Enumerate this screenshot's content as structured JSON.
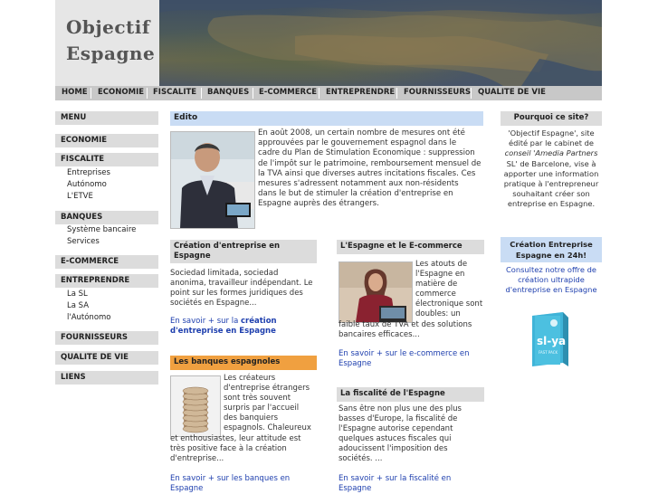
{
  "logo": {
    "line1": "Objectif",
    "line2": "Espagne"
  },
  "topnav": [
    "HOME",
    "ECONOMIE",
    "FISCALITE",
    "BANQUES",
    "E-COMMERCE",
    "ENTREPRENDRE",
    "FOURNISSEURS",
    "QUALITE DE VIE"
  ],
  "sidebar": {
    "menu": "MENU",
    "economie": "ECONOMIE",
    "fiscalite": "FISCALITE",
    "fiscalite_items": [
      "Entreprises",
      "Autónomo",
      "L'ETVE"
    ],
    "banques": "BANQUES",
    "banques_items": [
      "Système bancaire",
      "Services"
    ],
    "ecommerce": "E-COMMERCE",
    "entreprendre": "ENTREPRENDRE",
    "entreprendre_items": [
      "La SL",
      "La SA",
      "l'Autónomo"
    ],
    "fournisseurs": "FOURNISSEURS",
    "qualite": "QUALITE DE VIE",
    "liens": "LIENS"
  },
  "edito": {
    "title": "Edito",
    "lines": [
      "En août 2008, un certain nombre de mesures ont été",
      "approuvées par le gouvernement espagnol dans le",
      "cadre du Plan de Stimulation Economique : suppression",
      "de l'impôt sur le patrimoine, remboursement mensuel de",
      "la TVA ainsi que diverses autres incitations fiscales. Ces",
      "mesures s'adressent notamment aux non-résidents",
      "dans le but de stimuler la création d'entreprise en",
      "Espagne auprès des étrangers."
    ]
  },
  "creation": {
    "title_l1": "Création d'entreprise en",
    "title_l2": "Espagne",
    "lines": [
      "Sociedad limitada, sociedad",
      "anonima, travailleur indépendant. Le",
      "point sur les formes juridiques des",
      "sociétés en Espagne..."
    ],
    "link_l1a": "En savoir + sur la ",
    "link_l1b": "création",
    "link_l2": "d'entreprise en Espagne"
  },
  "ecommerce": {
    "title": "L'Espagne et le E-commerce",
    "lines": [
      "Les atouts de",
      "l'Espagne en",
      "matière de",
      "commerce",
      "électronique sont",
      "doubles: un",
      "faible taux de TVA et des solutions",
      "bancaires efficaces..."
    ],
    "link_l1": "En savoir + sur le e-commerce en",
    "link_l2": "Espagne"
  },
  "banques": {
    "title": "Les banques espagnoles",
    "lines": [
      "Les créateurs",
      "d'entreprise étrangers",
      "sont très souvent",
      "surpris par l'accueil",
      "des banquiers",
      "espagnols. Chaleureux",
      "et enthousiastes, leur attitude est",
      "très positive face à la création",
      "d'entreprise..."
    ],
    "link_l1": "En savoir + sur les banques en",
    "link_l2": "Espagne"
  },
  "fiscalite": {
    "title": "La fiscalité de l'Espagne",
    "lines": [
      "Sans être non plus une des plus",
      "basses d'Europe, la fiscalité de",
      "l'Espagne autorise cependant",
      "quelques astuces fiscales qui",
      "adoucissent l'imposition des",
      "sociétés. ..."
    ],
    "link_l1": "En savoir + sur la fiscalité en",
    "link_l2": "Espagne"
  },
  "right": {
    "head": "Pourquoi ce site?",
    "lines": [
      "'Objectif Espagne', site",
      "édité par le cabinet de",
      "conseil 'Amedia Partners",
      "SL' de Barcelone, vise à",
      "apporter une information",
      "pratique à l'entrepreneur",
      "souhaitant créer son",
      "entreprise en Espagne."
    ],
    "blue_l1": "Création Entreprise",
    "blue_l2": "Espagne en 24h!",
    "link_lines": [
      "Consultez notre offre de",
      "création ultrapide",
      "d'entreprise en Espagne"
    ],
    "box_label": "sl-ya",
    "box_sub": "FAST PACK"
  }
}
